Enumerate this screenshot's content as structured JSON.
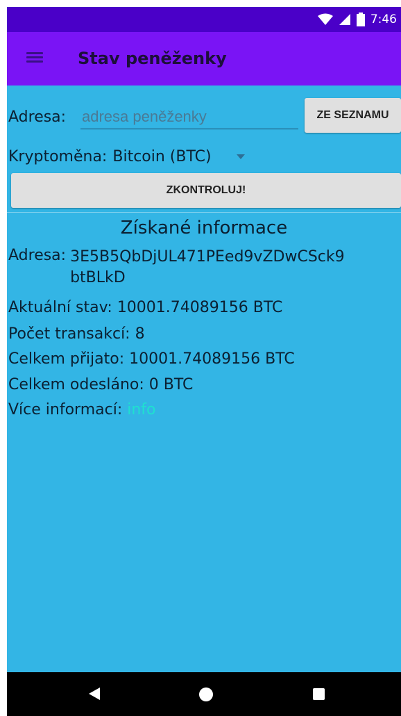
{
  "status_bar": {
    "time": "7:46",
    "icons": [
      "wifi-icon",
      "signal-icon",
      "battery-icon"
    ]
  },
  "app_bar": {
    "menu_icon": "hamburger-menu-icon",
    "title": "Stav peněženky"
  },
  "form": {
    "address_label": "Adresa:",
    "address_placeholder": "adresa peněženky",
    "address_value": "",
    "from_list_button": "ZE SEZNAMU",
    "crypto_label": "Kryptoměna:",
    "crypto_selected": "Bitcoin (BTC)",
    "check_button": "ZKONTROLUJ!"
  },
  "info": {
    "title": "Získané informace",
    "address_label": "Adresa:",
    "address_value": "3E5B5QbDjUL471PEed9vZDwCSck9btBLkD",
    "balance_label": "Aktuální stav:",
    "balance_value": "10001.74089156 BTC",
    "tx_count_label": "Počet transakcí:",
    "tx_count_value": "8",
    "received_label": "Celkem přijato:",
    "received_value": "10001.74089156 BTC",
    "sent_label": "Celkem odesláno:",
    "sent_value": "0 BTC",
    "more_label": "Více informací:",
    "more_link": "info"
  },
  "nav_bar": {
    "icons": [
      "back-icon",
      "home-icon",
      "recent-apps-icon"
    ]
  },
  "colors": {
    "status_bar": "#4a00c8",
    "app_bar": "#7a14f5",
    "content_bg": "#33b5e5",
    "link": "#1fe0d0"
  }
}
